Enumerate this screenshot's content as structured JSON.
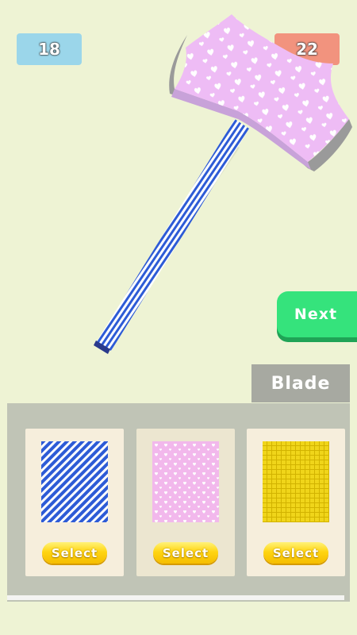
{
  "scores": {
    "left": "18",
    "right": "22"
  },
  "next_button": {
    "label": "Next"
  },
  "category_tab": {
    "label": "Blade"
  },
  "cards": [
    {
      "pattern": "blue-stripes",
      "button_label": "Select"
    },
    {
      "pattern": "pink-hearts",
      "button_label": "Select"
    },
    {
      "pattern": "yellow-grid",
      "button_label": "Select"
    }
  ],
  "colors": {
    "background": "#eef3d4",
    "blade": "#eebcf5",
    "handle_stripes": "#2d5bd6",
    "next_button": "#35e37c",
    "select_button": "#ffd512"
  }
}
